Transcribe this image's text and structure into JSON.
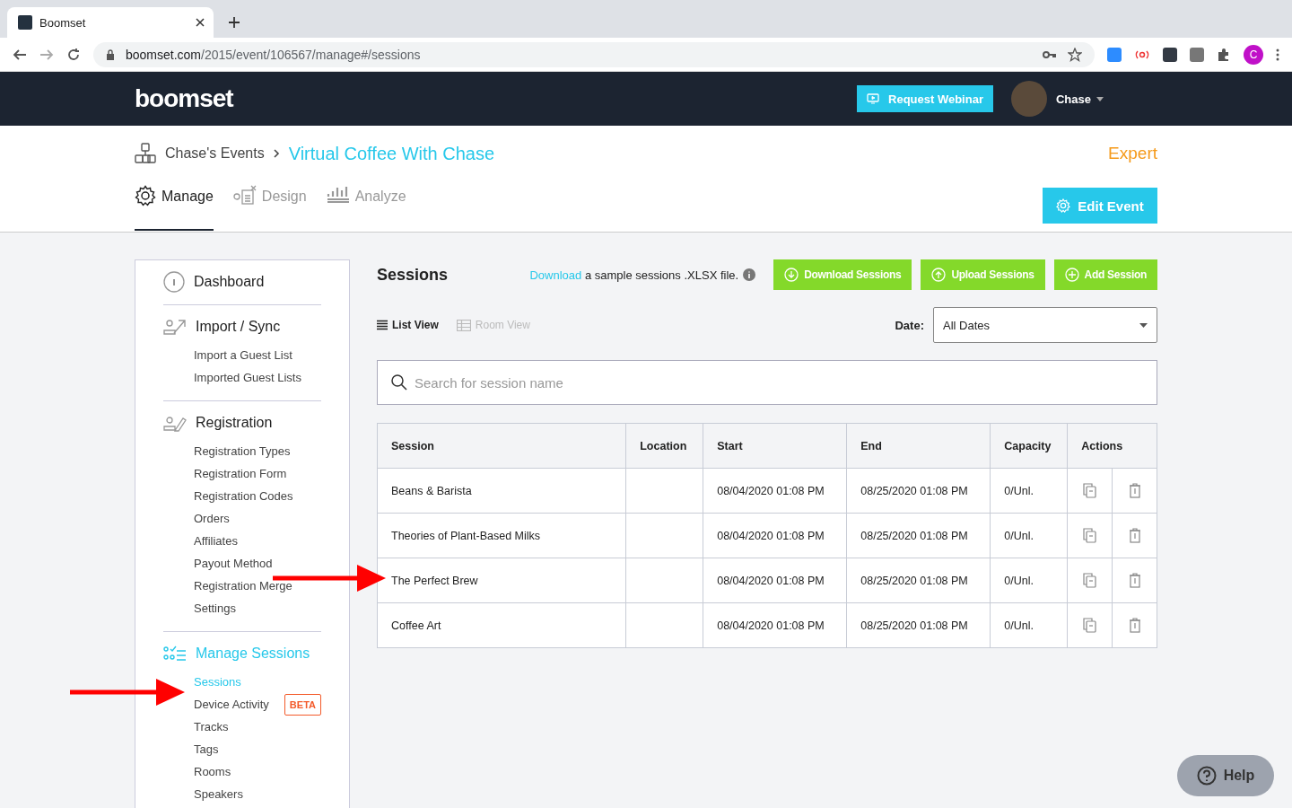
{
  "browser": {
    "tab_title": "Boomset",
    "url_host": "boomset.com",
    "url_path": "/2015/event/106567/manage#/sessions",
    "profile_initial": "C"
  },
  "header": {
    "logo": "boomset",
    "request_webinar": "Request Webinar",
    "user_name": "Chase"
  },
  "breadcrumb": {
    "parent": "Chase's Events",
    "current": "Virtual Coffee With Chase",
    "plan": "Expert"
  },
  "nav_tabs": [
    {
      "label": "Manage",
      "selected": true
    },
    {
      "label": "Design",
      "selected": false
    },
    {
      "label": "Analyze",
      "selected": false
    }
  ],
  "edit_event": "Edit Event",
  "sidebar": [
    {
      "title": "Dashboard",
      "selected": false
    },
    {
      "title": "Import / Sync",
      "selected": false,
      "items": [
        {
          "label": "Import a Guest List",
          "selected": false
        },
        {
          "label": "Imported Guest Lists",
          "selected": false
        }
      ]
    },
    {
      "title": "Registration",
      "selected": false,
      "items": [
        {
          "label": "Registration Types",
          "selected": false
        },
        {
          "label": "Registration Form",
          "selected": false
        },
        {
          "label": "Registration Codes",
          "selected": false
        },
        {
          "label": "Orders",
          "selected": false
        },
        {
          "label": "Affiliates",
          "selected": false
        },
        {
          "label": "Payout Method",
          "selected": false
        },
        {
          "label": "Registration Merge",
          "selected": false
        },
        {
          "label": "Settings",
          "selected": false
        }
      ]
    },
    {
      "title": "Manage Sessions",
      "selected": true,
      "items": [
        {
          "label": "Sessions",
          "selected": true
        },
        {
          "label": "Device Activity",
          "selected": false,
          "badge": "BETA"
        },
        {
          "label": "Tracks",
          "selected": false
        },
        {
          "label": "Tags",
          "selected": false
        },
        {
          "label": "Rooms",
          "selected": false
        },
        {
          "label": "Speakers",
          "selected": false
        }
      ]
    }
  ],
  "content": {
    "title": "Sessions",
    "download_link": "Download",
    "download_note": "a sample sessions .XLSX file.",
    "buttons": [
      {
        "label": "Download Sessions"
      },
      {
        "label": "Upload Sessions"
      },
      {
        "label": "Add Session"
      }
    ],
    "views": [
      {
        "label": "List View",
        "selected": true
      },
      {
        "label": "Room View",
        "selected": false
      }
    ],
    "date_label": "Date:",
    "date_value": "All Dates",
    "search_placeholder": "Search for session name"
  },
  "table": {
    "columns": [
      "Session",
      "Location",
      "Start",
      "End",
      "Capacity",
      "Actions"
    ],
    "rows": [
      {
        "session": "Beans & Barista",
        "start": "08/04/2020 01:08 PM",
        "end": "08/25/2020 01:08 PM",
        "capacity": "0/Unl."
      },
      {
        "session": "Theories of Plant-Based Milks",
        "start": "08/04/2020 01:08 PM",
        "end": "08/25/2020 01:08 PM",
        "capacity": "0/Unl."
      },
      {
        "session": "The Perfect Brew",
        "start": "08/04/2020 01:08 PM",
        "end": "08/25/2020 01:08 PM",
        "capacity": "0/Unl."
      },
      {
        "session": "Coffee Art",
        "start": "08/04/2020 01:08 PM",
        "end": "08/25/2020 01:08 PM",
        "capacity": "0/Unl."
      }
    ]
  },
  "help": "Help"
}
